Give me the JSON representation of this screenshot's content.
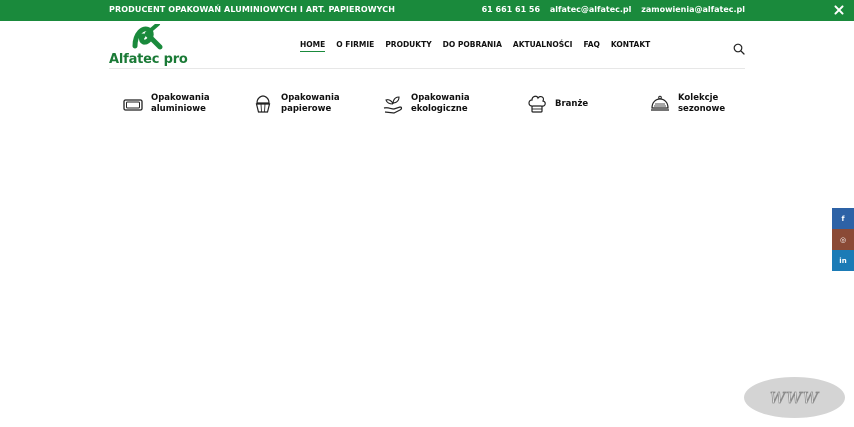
{
  "topbar": {
    "text": "PRODUCENT OPAKOWAŃ ALUMINIOWYCH I ART. PAPIEROWYCH",
    "phone": "61 661 61 56",
    "email1": "alfatec@alfatec.pl",
    "email2": "zamowienia@alfatec.pl",
    "bg": "#1a8a3c"
  },
  "logo": {
    "text": "Alfatec pro"
  },
  "nav": [
    "HOME",
    "O FIRMIE",
    "PRODUKTY",
    "DO POBRANIA",
    "AKTUALNOŚCI",
    "FAQ",
    "KONTAKT"
  ],
  "categories": [
    {
      "line1": "Opakowania",
      "line2": "aluminiowe",
      "icon": "tray-icon"
    },
    {
      "line1": "Opakowania",
      "line2": "papierowe",
      "icon": "cupcake-icon"
    },
    {
      "line1": "Opakowania",
      "line2": "ekologiczne",
      "icon": "eco-hand-icon"
    },
    {
      "line1": "Branże",
      "line2": "",
      "icon": "chef-hat-icon"
    },
    {
      "line1": "Kolekcje",
      "line2": "sezonowe",
      "icon": "cloche-icon"
    }
  ],
  "social": {
    "facebook": "f",
    "instagram": "◎",
    "linkedin": "in"
  },
  "badge": {
    "text": "WWW"
  }
}
